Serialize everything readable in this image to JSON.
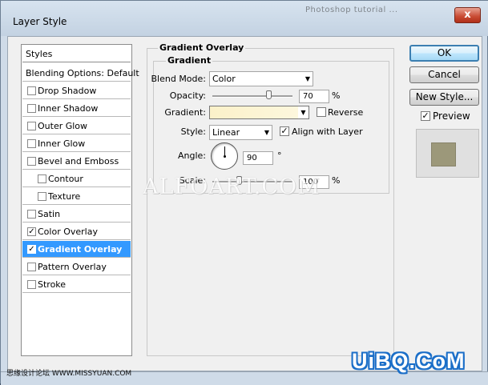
{
  "window": {
    "title": "Layer Style",
    "close_glyph": "x",
    "bg_text": "Photoshop tutorial  ...  "
  },
  "left_list": {
    "header": "Styles",
    "items": [
      {
        "label": "Blending Options: Default",
        "has_checkbox": false,
        "checked": false,
        "selected": false,
        "indent": false
      },
      {
        "label": "Drop Shadow",
        "has_checkbox": true,
        "checked": false,
        "selected": false,
        "indent": false
      },
      {
        "label": "Inner Shadow",
        "has_checkbox": true,
        "checked": false,
        "selected": false,
        "indent": false
      },
      {
        "label": "Outer Glow",
        "has_checkbox": true,
        "checked": false,
        "selected": false,
        "indent": false
      },
      {
        "label": "Inner Glow",
        "has_checkbox": true,
        "checked": false,
        "selected": false,
        "indent": false
      },
      {
        "label": "Bevel and Emboss",
        "has_checkbox": true,
        "checked": false,
        "selected": false,
        "indent": false
      },
      {
        "label": "Contour",
        "has_checkbox": true,
        "checked": false,
        "selected": false,
        "indent": true
      },
      {
        "label": "Texture",
        "has_checkbox": true,
        "checked": false,
        "selected": false,
        "indent": true
      },
      {
        "label": "Satin",
        "has_checkbox": true,
        "checked": false,
        "selected": false,
        "indent": false
      },
      {
        "label": "Color Overlay",
        "has_checkbox": true,
        "checked": true,
        "selected": false,
        "indent": false
      },
      {
        "label": "Gradient Overlay",
        "has_checkbox": true,
        "checked": true,
        "selected": true,
        "indent": false
      },
      {
        "label": "Pattern Overlay",
        "has_checkbox": true,
        "checked": false,
        "selected": false,
        "indent": false
      },
      {
        "label": "Stroke",
        "has_checkbox": true,
        "checked": false,
        "selected": false,
        "indent": false
      }
    ]
  },
  "panel": {
    "section_title": "Gradient Overlay",
    "group_title": "Gradient",
    "blend_mode": {
      "label": "Blend Mode:",
      "value": "Color"
    },
    "opacity": {
      "label": "Opacity:",
      "value": "70",
      "unit": "%",
      "level": 0.7
    },
    "gradient": {
      "label": "Gradient:",
      "reverse_label": "Reverse",
      "reverse_checked": false,
      "colors": [
        "#fbf1c9",
        "#fdf7dd"
      ]
    },
    "style": {
      "label": "Style:",
      "value": "Linear",
      "align_label": "Align with Layer",
      "align_checked": true
    },
    "angle": {
      "label": "Angle:",
      "value": "90",
      "unit": "°"
    },
    "scale": {
      "label": "Scale:",
      "value": "100",
      "unit": "%",
      "level": 0.33
    }
  },
  "buttons": {
    "ok": "OK",
    "cancel": "Cancel",
    "new_style": "New Style...",
    "preview_label": "Preview",
    "preview_checked": true,
    "preview_color": "#9c987a"
  },
  "watermarks": {
    "center": "ALFOART.COM",
    "bottom_left": "思缘设计论坛 WWW.MISSYUAN.COM",
    "bottom_right": "UiBQ.CoM"
  },
  "glyphs": {
    "check": "✓",
    "dropdown_arrow": "▼"
  }
}
